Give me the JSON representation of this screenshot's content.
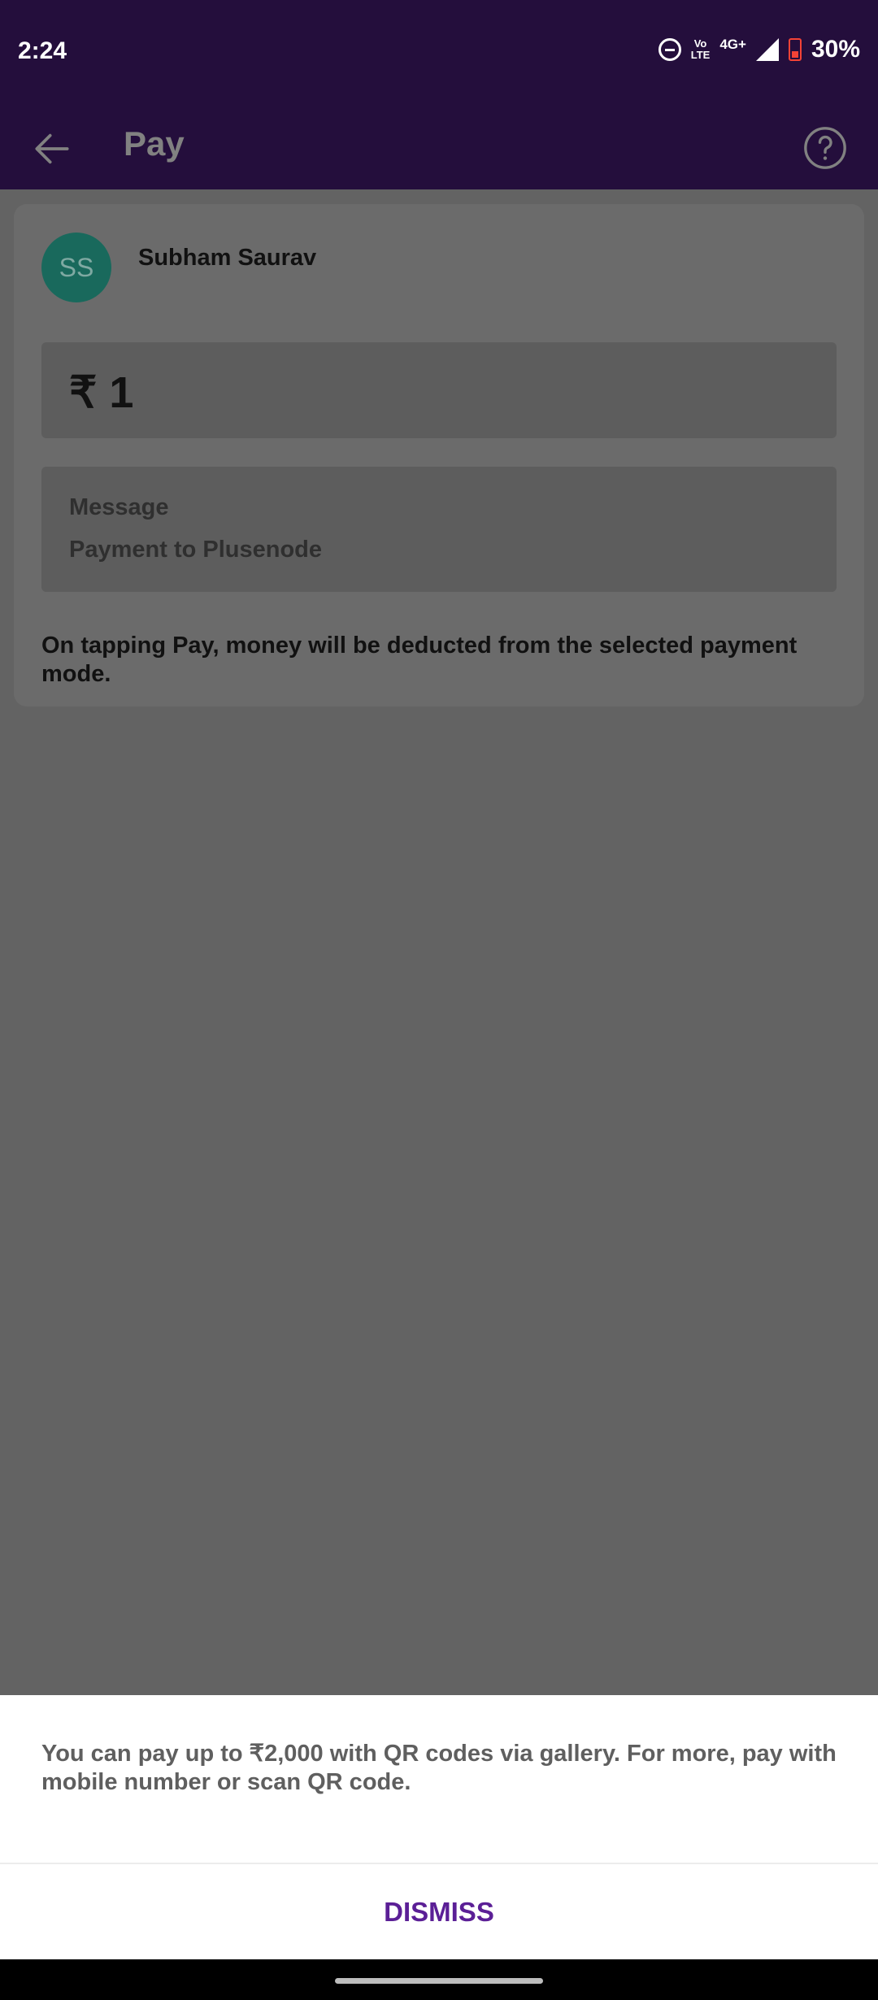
{
  "status_bar": {
    "time": "2:24",
    "volte_top": "Vo",
    "volte_bottom": "LTE",
    "network": "4G+",
    "battery": "30%",
    "icons": [
      "do-not-disturb-icon",
      "volte-icon",
      "signal-icon",
      "battery-icon"
    ]
  },
  "app_bar": {
    "title": "Pay",
    "back_icon": "arrow-left-icon",
    "help_icon": "question-circle-icon"
  },
  "payee": {
    "initials": "SS",
    "name": "Subham Saurav",
    "avatar_color": "#19695c"
  },
  "amount": {
    "display": "₹ 1"
  },
  "message": {
    "label": "Message",
    "value": "Payment to Plusenode"
  },
  "disclaimer": "On tapping Pay, money will be deducted from the selected payment mode.",
  "bottom_sheet": {
    "text": "You can pay up to ₹2,000 with QR codes via gallery. For more, pay with mobile number or scan QR code.",
    "dismiss_label": "DISMISS"
  },
  "colors": {
    "header": "#240e3c",
    "accent": "#5b1f96",
    "overlay": "#636363"
  }
}
